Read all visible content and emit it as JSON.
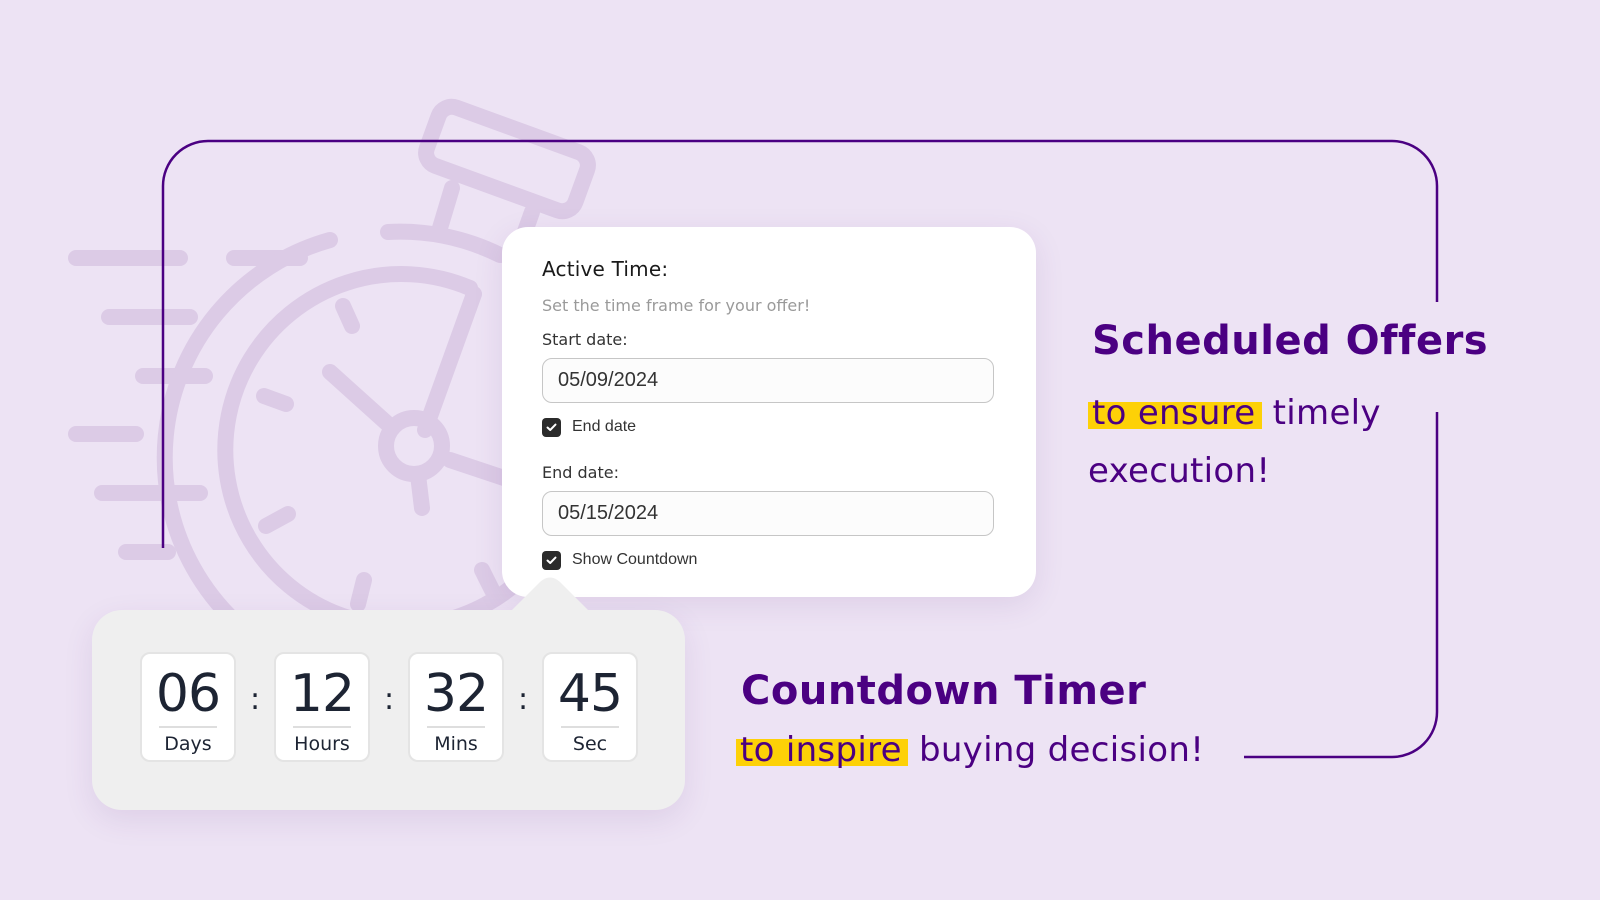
{
  "colors": {
    "background": "#ede3f4",
    "accent_purple": "#4b0082",
    "illustration_lilac": "#dccbe6",
    "highlight_yellow": "#fdd107",
    "card_bg": "#ffffff",
    "countdown_panel_bg": "#efefef",
    "checkbox_fill": "#2b2b2b",
    "timer_digits": "#1d2433"
  },
  "background_illustration": {
    "icon": "stopwatch-icon",
    "speed_lines_icon": "motion-lines-icon"
  },
  "active_time_card": {
    "title": "Active Time:",
    "subtitle": "Set the time frame for your offer!",
    "start_date": {
      "label": "Start date:",
      "value": "05/09/2024"
    },
    "end_date_toggle": {
      "label": "End date",
      "checked": true,
      "icon": "checkmark-icon"
    },
    "end_date": {
      "label": "End date:",
      "value": "05/15/2024"
    },
    "show_countdown_toggle": {
      "label": "Show Countdown",
      "checked": true,
      "icon": "checkmark-icon"
    }
  },
  "countdown": {
    "separator": ":",
    "units": [
      {
        "value": "06",
        "label": "Days"
      },
      {
        "value": "12",
        "label": "Hours"
      },
      {
        "value": "32",
        "label": "Mins"
      },
      {
        "value": "45",
        "label": "Sec"
      }
    ]
  },
  "features": [
    {
      "title": "Scheduled Offers",
      "highlight": "to ensure",
      "rest_line1": "timely",
      "rest_line2": "execution!"
    },
    {
      "title": "Countdown Timer",
      "highlight": "to inspire",
      "rest_line1": "buying decision!"
    }
  ]
}
